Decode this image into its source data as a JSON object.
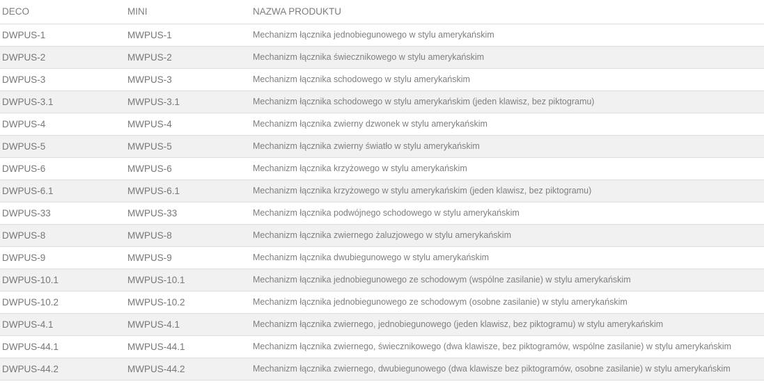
{
  "headers": {
    "deco": "DECO",
    "mini": "MINI",
    "name": "NAZWA PRODUKTU"
  },
  "rows": [
    {
      "deco": "DWPUS-1",
      "mini": "MWPUS-1",
      "name": "Mechanizm łącznika jednobiegunowego w stylu amerykańskim"
    },
    {
      "deco": "DWPUS-2",
      "mini": "MWPUS-2",
      "name": "Mechanizm łącznika świecznikowego w stylu amerykańskim"
    },
    {
      "deco": "DWPUS-3",
      "mini": "MWPUS-3",
      "name": "Mechanizm łącznika schodowego w stylu amerykańskim"
    },
    {
      "deco": "DWPUS-3.1",
      "mini": "MWPUS-3.1",
      "name": "Mechanizm łącznika schodowego w stylu amerykańskim (jeden klawisz, bez piktogramu)"
    },
    {
      "deco": "DWPUS-4",
      "mini": "MWPUS-4",
      "name": "Mechanizm łącznika zwierny dzwonek w stylu amerykańskim"
    },
    {
      "deco": "DWPUS-5",
      "mini": "MWPUS-5",
      "name": "Mechanizm łącznika zwierny światło w stylu amerykańskim"
    },
    {
      "deco": "DWPUS-6",
      "mini": "MWPUS-6",
      "name": "Mechanizm łącznika krzyżowego w stylu amerykańskim"
    },
    {
      "deco": "DWPUS-6.1",
      "mini": "MWPUS-6.1",
      "name": "Mechanizm łącznika krzyżowego w stylu amerykańskim (jeden klawisz, bez piktogramu)"
    },
    {
      "deco": "DWPUS-33",
      "mini": "MWPUS-33",
      "name": "Mechanizm łącznika podwójnego schodowego w stylu amerykańskim"
    },
    {
      "deco": "DWPUS-8",
      "mini": "MWPUS-8",
      "name": "Mechanizm łącznika zwiernego żaluzjowego w stylu amerykańskim"
    },
    {
      "deco": "DWPUS-9",
      "mini": "MWPUS-9",
      "name": "Mechanizm łącznika dwubiegunowego w stylu amerykańskim"
    },
    {
      "deco": "DWPUS-10.1",
      "mini": "MWPUS-10.1",
      "name": "Mechanizm łącznika jednobiegunowego ze schodowym (wspólne zasilanie) w  stylu amerykańskim"
    },
    {
      "deco": "DWPUS-10.2",
      "mini": "MWPUS-10.2",
      "name": "Mechanizm łącznika jednobiegunowego ze schodowym (osobne zasilanie) w  stylu amerykańskim"
    },
    {
      "deco": "DWPUS-4.1",
      "mini": "MWPUS-4.1",
      "name": "Mechanizm łącznika zwiernego, jednobiegunowego (jeden klawisz, bez piktogramu) w stylu amerykańskim"
    },
    {
      "deco": "DWPUS-44.1",
      "mini": "MWPUS-44.1",
      "name": "Mechanizm łącznika zwiernego, świecznikowego (dwa klawisze, bez piktogramów, wspólne zasilanie) w stylu amerykańskim"
    },
    {
      "deco": "DWPUS-44.2",
      "mini": "MWPUS-44.2",
      "name": "Mechanizm łącznika zwiernego, dwubiegunowego (dwa klawisze bez piktogramów, osobne zasilanie) w stylu amerykańskim"
    }
  ]
}
